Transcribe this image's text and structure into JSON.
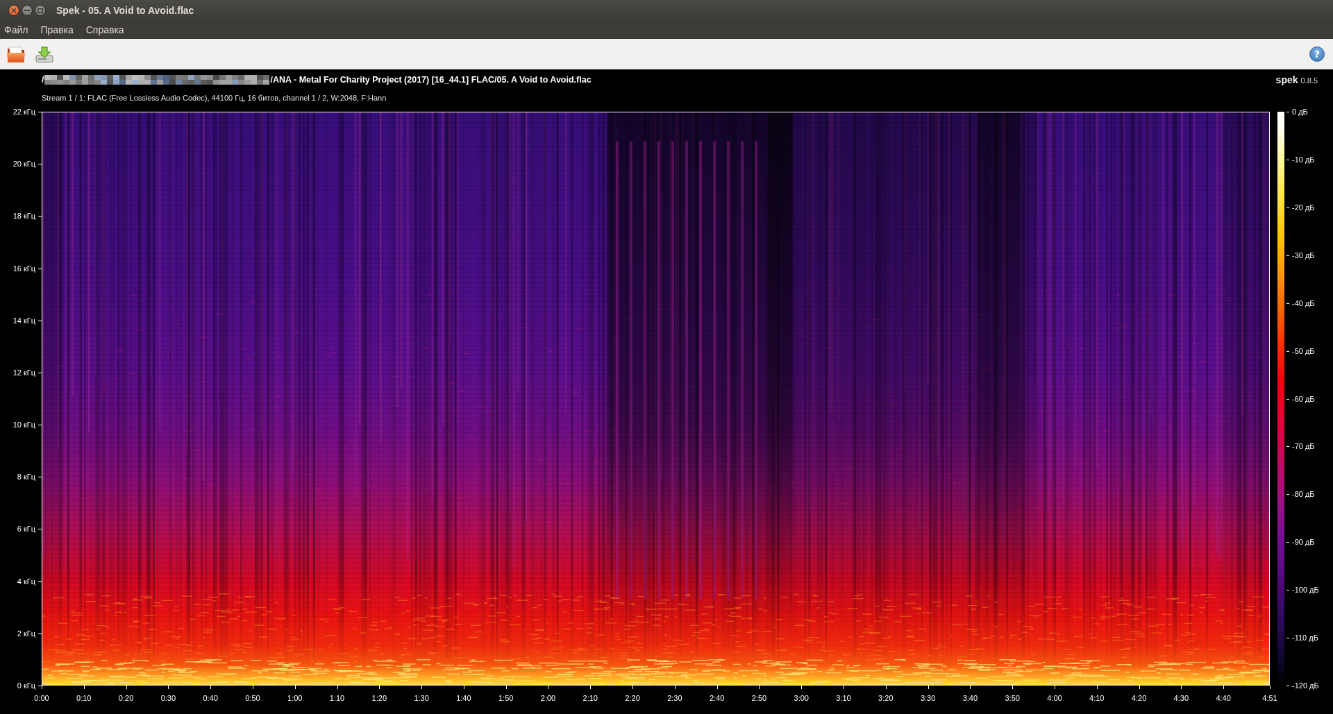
{
  "window": {
    "title": "Spek - 05. A Void to Avoid.flac"
  },
  "menu": [
    "Файл",
    "Правка",
    "Справка"
  ],
  "toolbar": {
    "help_label": "?"
  },
  "file_path": {
    "start": "/",
    "rest": "/ANA - Metal For Charity Project (2017) [16_44.1] FLAC/05. A Void to Avoid.flac"
  },
  "stream_info": "Stream 1 / 1: FLAC (Free Lossless Audio Codec), 44100 Гц, 16 битов, channel 1 / 2, W:2048, F:Hann",
  "branding": {
    "name": "spek",
    "version": "0.8.5"
  },
  "frequency_axis": [
    "22 кГц",
    "20 кГц",
    "18 кГц",
    "16 кГц",
    "14 кГц",
    "12 кГц",
    "10 кГц",
    "8 кГц",
    "6 кГц",
    "4 кГц",
    "2 кГц",
    "0 кГц"
  ],
  "time_axis": [
    "0:00",
    "0:10",
    "0:20",
    "0:30",
    "0:40",
    "0:50",
    "1:00",
    "1:10",
    "1:20",
    "1:30",
    "1:40",
    "1:50",
    "2:00",
    "2:10",
    "2:20",
    "2:30",
    "2:40",
    "2:50",
    "3:00",
    "3:10",
    "3:20",
    "3:30",
    "3:40",
    "3:50",
    "4:00",
    "4:10",
    "4:20",
    "4:30",
    "4:40",
    "4:51"
  ],
  "level_scale": [
    "0 дБ",
    "-10 дБ",
    "-20 дБ",
    "-30 дБ",
    "-40 дБ",
    "-50 дБ",
    "-60 дБ",
    "-70 дБ",
    "-80 дБ",
    "-90 дБ",
    "-100 дБ",
    "-110 дБ",
    "-120 дБ"
  ]
}
